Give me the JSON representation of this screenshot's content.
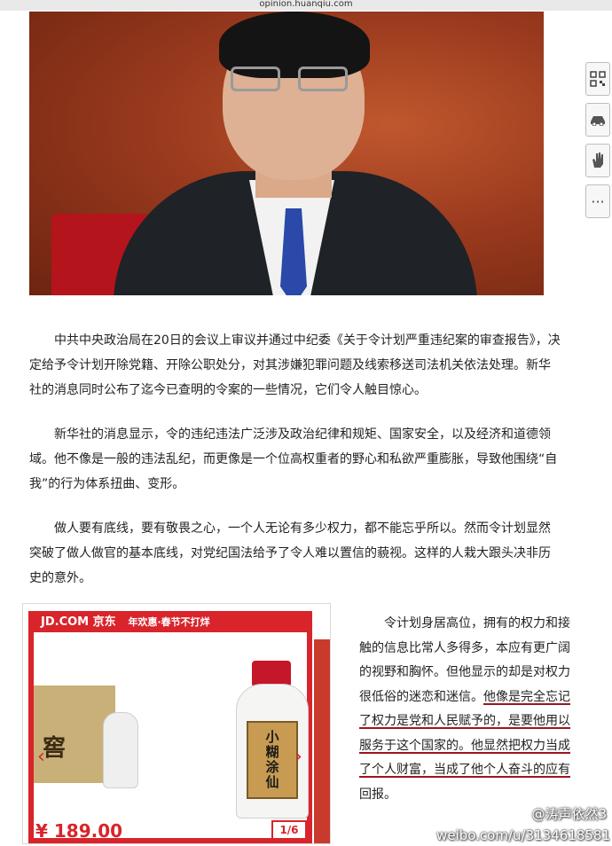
{
  "url_bar": {
    "text": "opinion.huanqiu.com"
  },
  "sidebar": {
    "buttons": [
      "qr-code",
      "car",
      "hand",
      "more"
    ],
    "more_label": "···"
  },
  "article": {
    "paragraphs": [
      "中共中央政治局在20日的会议上审议并通过中纪委《关于令计划严重违纪案的审查报告》，决定给予令计划开除党籍、开除公职处分，对其涉嫌犯罪问题及线索移送司法机关依法处理。新华社的消息同时公布了迄今已查明的令案的一些情况，它们令人触目惊心。",
      "新华社的消息显示，令的违纪违法广泛涉及政治纪律和规矩、国家安全，以及经济和道德领域。他不像是一般的违法乱纪，而更像是一个位高权重者的野心和私欲严重膨胀，导致他围绕“自我”的行为体系扭曲、变形。",
      "做人要有底线，要有敬畏之心，一个人无论有多少权力，都不能忘乎所以。然而令计划显然突破了做人做官的基本底线，对党纪国法给予了令人难以置信的藐视。这样的人栽大跟头决非历史的意外。"
    ],
    "side_paragraph_plain": "令计划身居高位，拥有的权力和接触的信息比常人多得多，本应有更广阔的视野和胸怀。但他显示的却是对权力很低俗的迷恋和迷信。",
    "side_paragraph_underlined": "他像是完全忘记了权力是党和人民赋予的，是要他用以服务于这个国家的。他显然把权力当成了个人财富，当成了他个人奋斗的应有",
    "side_paragraph_end": "回报。"
  },
  "ad": {
    "brand": "JD.COM 京东",
    "promo": "年欢惠·春节不打烊",
    "box_text": "窖",
    "product_name": "小糊涂仙",
    "price": "¥ 189.00",
    "pager": "1/6",
    "prev": "‹",
    "next": "›"
  },
  "watermark": {
    "handle": "@涛声依然3",
    "url": "weibo.com/u/3134618581"
  },
  "colors": {
    "jd_red": "#d9242b",
    "underline": "#9c1420"
  }
}
